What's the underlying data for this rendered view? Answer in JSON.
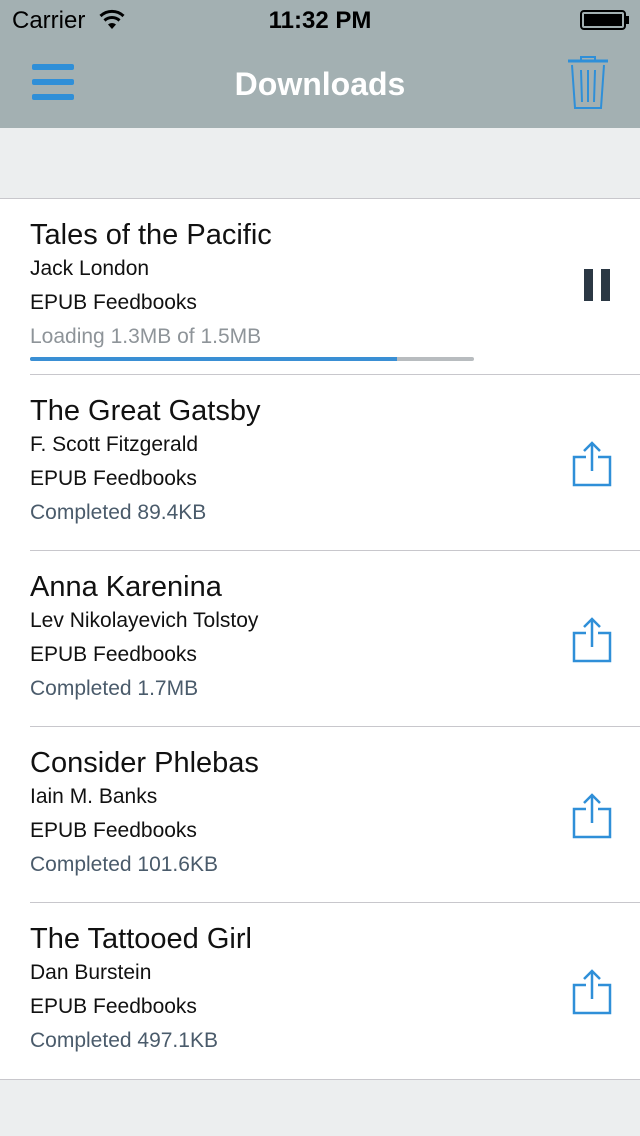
{
  "status_bar": {
    "carrier": "Carrier",
    "time": "11:32 PM"
  },
  "nav": {
    "title": "Downloads",
    "menu_icon": "hamburger-menu-icon",
    "trash_icon": "trash-icon"
  },
  "colors": {
    "nav_bg": "#a3b0b2",
    "accent": "#2f8fd8",
    "background": "#eceeef"
  },
  "downloads": [
    {
      "title": "Tales of the Pacific",
      "author": "Jack London",
      "format": "EPUB Feedbooks",
      "status": "Loading 1.3MB of 1.5MB",
      "state": "loading",
      "progress": 0.827,
      "action_icon": "pause-icon"
    },
    {
      "title": "The Great Gatsby",
      "author": "F. Scott Fitzgerald",
      "format": "EPUB Feedbooks",
      "status": "Completed 89.4KB",
      "state": "completed",
      "action_icon": "share-icon"
    },
    {
      "title": "Anna Karenina",
      "author": "Lev Nikolayevich Tolstoy",
      "format": "EPUB Feedbooks",
      "status": "Completed 1.7MB",
      "state": "completed",
      "action_icon": "share-icon"
    },
    {
      "title": "Consider Phlebas",
      "author": "Iain M. Banks",
      "format": "EPUB Feedbooks",
      "status": "Completed 101.6KB",
      "state": "completed",
      "action_icon": "share-icon"
    },
    {
      "title": "The Tattooed Girl",
      "author": "Dan Burstein",
      "format": "EPUB Feedbooks",
      "status": "Completed 497.1KB",
      "state": "completed",
      "action_icon": "share-icon"
    }
  ]
}
